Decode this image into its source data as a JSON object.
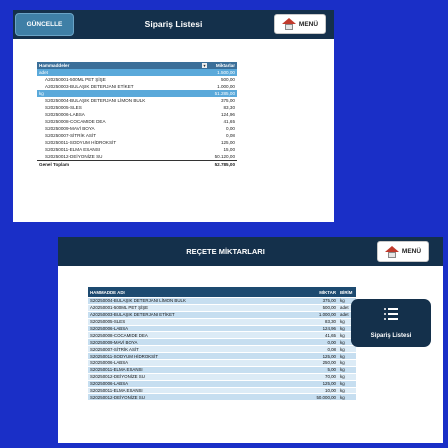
{
  "top": {
    "guncelle_label": "GÜNCELLE",
    "title": "Sipariş Listesi",
    "menu_label": "MENÜ",
    "pivot": {
      "header": [
        "Hammaddeler",
        "Miktarlar"
      ],
      "groups": [
        {
          "name": "adet",
          "total": "1.500,00",
          "items": [
            [
              "A20250001-500ML PET ŞİŞE",
              "500,00"
            ],
            [
              "A20250003-BULAŞIK DETERJANI ETİKET",
              "1.000,00"
            ]
          ]
        },
        {
          "name": "kg",
          "total": "51.285,00",
          "items": [
            [
              "S20250004-BULAŞIK DETERJANI LİMON BULK",
              "375,00"
            ],
            [
              "S20250005-SLES",
              "83,30"
            ],
            [
              "S20250006-LABSA",
              "124,96"
            ],
            [
              "S20250008-COCAMIDE DEA",
              "41,65"
            ],
            [
              "S20250009-MAVİ BOYA",
              "0,00"
            ],
            [
              "S20250007-SİTRİK ASİT",
              "0,08"
            ],
            [
              "S20250011-SODYUM HİDROKSİT",
              "125,00"
            ],
            [
              "S20250011-ELMA ESANSI",
              "15,00"
            ],
            [
              "S20250012-DEİYONİZE SU",
              "50.120,00"
            ]
          ]
        }
      ],
      "grand_total_label": "Genel Toplam",
      "grand_total_value": "52.785,00"
    }
  },
  "bottom": {
    "title": "REÇETE MİKTARLARI",
    "menu_label": "MENÜ",
    "columns": [
      "HAMMADDE ADI",
      "MİKTAR",
      "BİRİM"
    ],
    "rows": [
      [
        "S20250004-BULAŞIK DETERJANI LİMON BULK",
        "375,00",
        "kg"
      ],
      [
        "A20250001-500ML PET ŞİŞE",
        "500,00",
        "adet"
      ],
      [
        "A20250003-BULAŞIK DETERJANI ETİKET",
        "1.000,00",
        "adet"
      ],
      [
        "S20250005-SLES",
        "83,30",
        "kg"
      ],
      [
        "S20250006-LABSA",
        "124,96",
        "kg"
      ],
      [
        "S20250008-COCAMIDE DEA",
        "41,65",
        "kg"
      ],
      [
        "S20250009-MAVİ BOYA",
        "0,00",
        "kg"
      ],
      [
        "S20250007-SİTRİK ASİT",
        "0,08",
        "kg"
      ],
      [
        "S20250011-SODYUM HİDROKSİT",
        "125,00",
        "kg"
      ],
      [
        "S20250006-LABSA",
        "250,00",
        "kg"
      ],
      [
        "S20250011-ELMA ESANSI",
        "5,00",
        "kg"
      ],
      [
        "S20250012-DEİYONİZE SU",
        "70,00",
        "kg"
      ],
      [
        "S20250006-LABSA",
        "125,00",
        "kg"
      ],
      [
        "S20250011-ELMA ESANSI",
        "10,00",
        "kg"
      ],
      [
        "S20250012-DEİYONİZE SU",
        "50.000,00",
        "kg"
      ]
    ],
    "side_button_label": "Sipariş Listesi"
  },
  "colors": {
    "background": "#1a2fc7",
    "header_navy": "#14304b",
    "pivot_group": "#5aa9da",
    "table_row_light": "#dcebf6"
  }
}
